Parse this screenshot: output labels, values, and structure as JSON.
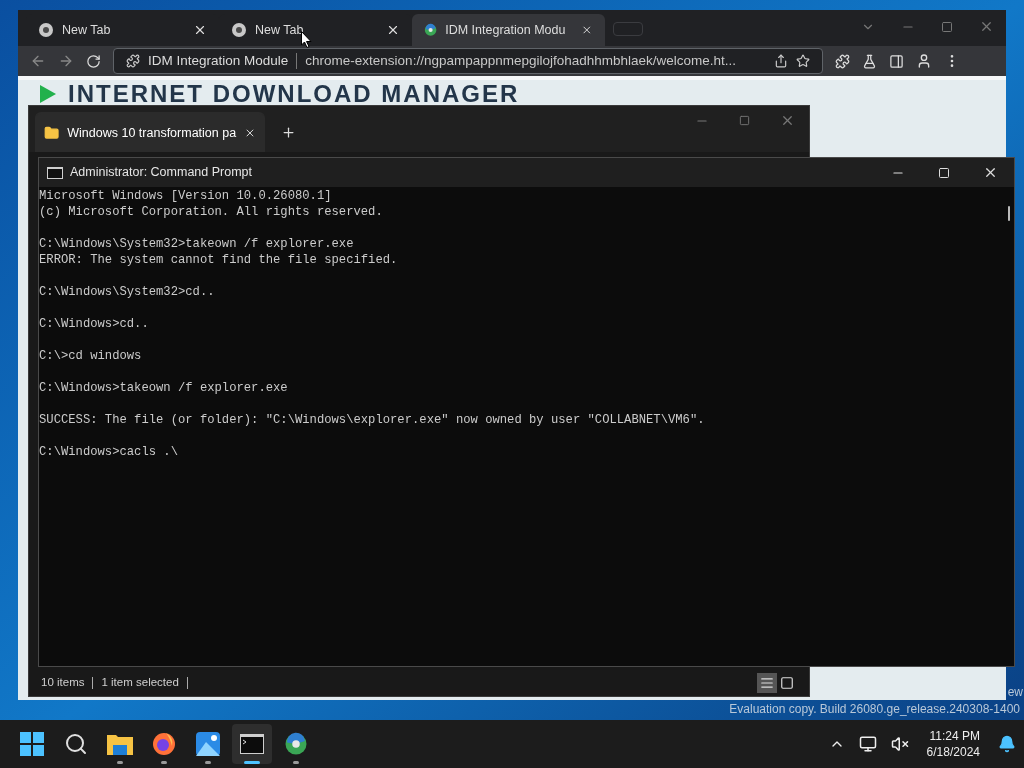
{
  "browser": {
    "tabs": [
      {
        "label": "New Tab",
        "kind": "chrome",
        "selected": false
      },
      {
        "label": "New Tab",
        "kind": "chrome",
        "selected": false
      },
      {
        "label": "IDM Integration Modu",
        "kind": "idm",
        "selected": true
      }
    ],
    "address": {
      "site": "IDM Integration Module",
      "url": "chrome-extension://ngpampappnmepgilojfohadhhmbhlaek/welcome.ht..."
    },
    "page_heading": "INTERNET DOWNLOAD MANAGER"
  },
  "explorer": {
    "tab": {
      "label": "Windows 10 transformation pa",
      "selected": true
    },
    "status": [
      "10 items",
      "1 item selected"
    ]
  },
  "cmd": {
    "title": "Administrator: Command Prompt",
    "blocks": [
      [
        "Microsoft Windows [Version 10.0.26080.1]",
        "(c) Microsoft Corporation. All rights reserved."
      ],
      [
        "C:\\Windows\\System32>takeown /f explorer.exe",
        "ERROR: The system cannot find the file specified."
      ],
      [
        "C:\\Windows\\System32>cd.."
      ],
      [
        "C:\\Windows>cd.."
      ],
      [
        "C:\\>cd windows"
      ],
      [
        "C:\\Windows>takeown /f explorer.exe"
      ],
      [
        "SUCCESS: The file (or folder): \"C:\\Windows\\explorer.exe\" now owned by user \"COLLABNET\\VM6\"."
      ],
      [
        "C:\\Windows>cacls .\\"
      ]
    ]
  },
  "desktop": {
    "watermark": [
      "ew",
      "Evaluation copy. Build 26080.ge_release.240308-1400"
    ]
  },
  "taskbar": {
    "apps": [
      {
        "kind": "start",
        "running": false,
        "active": false
      },
      {
        "kind": "search",
        "running": false,
        "active": false
      },
      {
        "kind": "explorer",
        "running": true,
        "active": false
      },
      {
        "kind": "firefox",
        "running": true,
        "active": false
      },
      {
        "kind": "photos",
        "running": true,
        "active": false
      },
      {
        "kind": "terminal",
        "running": true,
        "active": true
      },
      {
        "kind": "idm",
        "running": true,
        "active": false
      }
    ],
    "time": "11:24 PM",
    "date": "6/18/2024"
  }
}
